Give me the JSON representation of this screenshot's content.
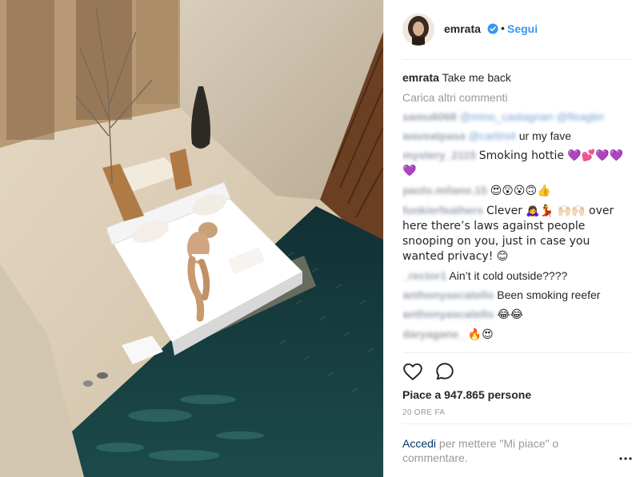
{
  "post": {
    "username": "emrata",
    "follow_label": "Segui",
    "separator": "•",
    "caption": {
      "username": "emrata",
      "text": "Take me back"
    },
    "load_more": "Carica altri commenti",
    "comments": [
      {
        "user": "samu6068",
        "text": "@mino_castagnan @fleagler",
        "blurred_text": true
      },
      {
        "user": "waveatpasa",
        "text": "@cartini4 ur my fave",
        "blurred_prefix": "@cartini4",
        "visible_text": "ur my fave"
      },
      {
        "user": "mystery_2115",
        "text": "Smoking hottie 💜💕💜💜💜"
      },
      {
        "user": "paolo.milano.15",
        "text": "😍😲😮🙃👍"
      },
      {
        "user": "funkierfeathers",
        "text": "Clever 🙇‍♀️💃 🙌🏻🙌🏻 over here there’s laws against people snooping on you, just in case you wanted privacy! 😊"
      },
      {
        "user": "_rector1",
        "text": "Ain’t it cold outside????"
      },
      {
        "user": "anthonyascatello",
        "text": "Been smoking reefer"
      },
      {
        "user": "anthonyascatello",
        "text": "😂😂"
      },
      {
        "user": "daryagane_",
        "text": "🔥😍"
      }
    ],
    "likes": "Piace a 947.865 persone",
    "timestamp": "20 ORE FA",
    "login_link": "Accedi",
    "login_text": "per mettere \"Mi piace\" o commentare.",
    "icons": {
      "verified": "verified-badge-icon",
      "like": "heart-icon",
      "comment": "comment-bubble-icon",
      "more": "more-options-icon"
    },
    "colors": {
      "follow": "#3897f0",
      "verified": "#3897f0",
      "link": "#003569",
      "muted": "#999999"
    }
  }
}
